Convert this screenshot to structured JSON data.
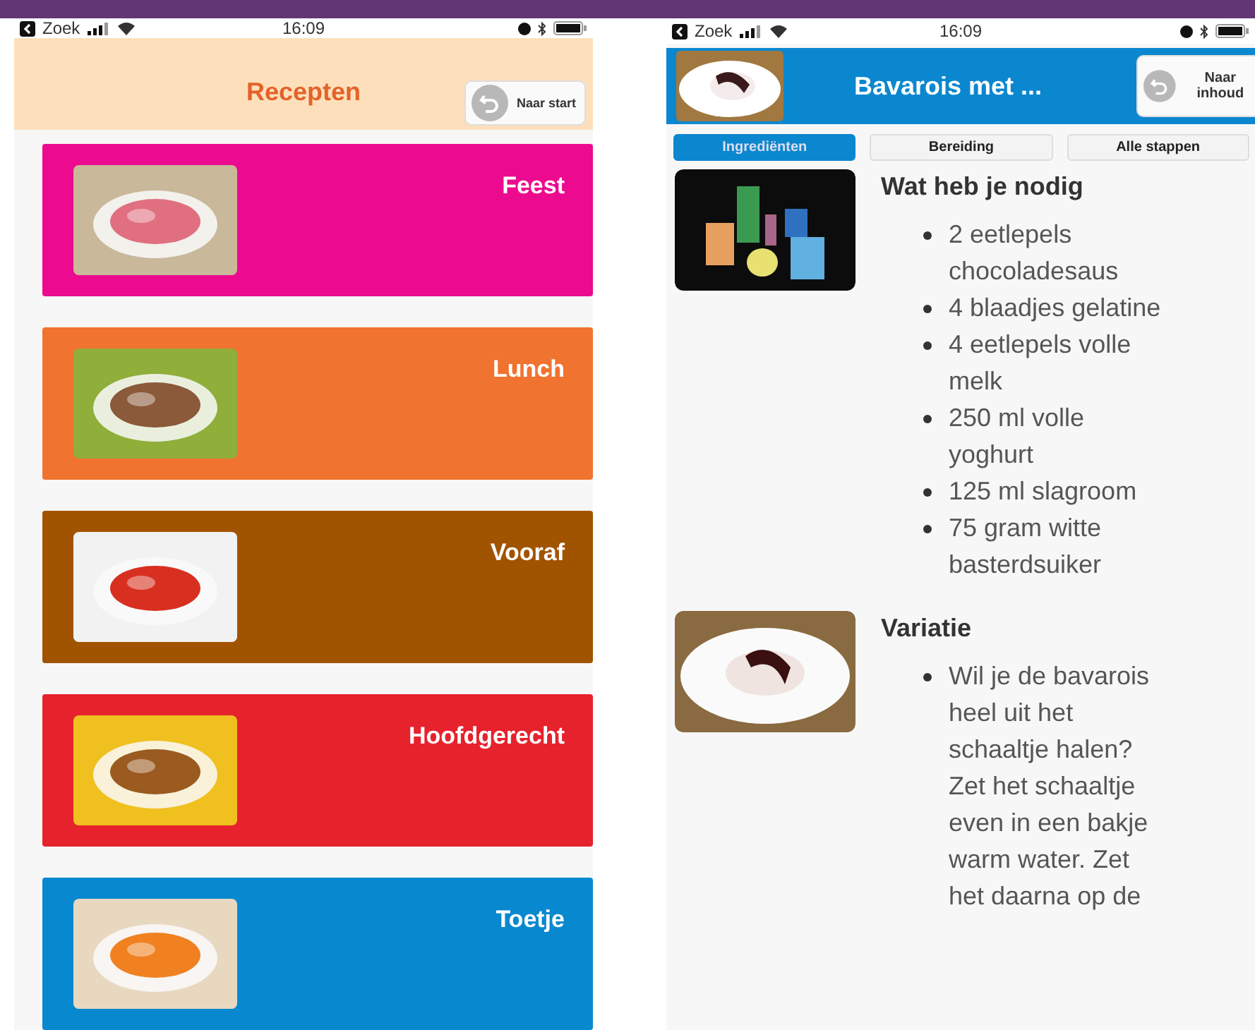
{
  "left_screen": {
    "status_bar": {
      "back_label": "Zoek",
      "time": "16:09"
    },
    "header": {
      "title": "Recepten",
      "button": "Naar start"
    },
    "categories": [
      {
        "label": "Feest",
        "color": "#ec0a8e"
      },
      {
        "label": "Lunch",
        "color": "#f17330"
      },
      {
        "label": "Vooraf",
        "color": "#a15400"
      },
      {
        "label": "Hoofdgerecht",
        "color": "#e6222c"
      },
      {
        "label": "Toetje",
        "color": "#0889cf"
      }
    ]
  },
  "right_screen": {
    "status_bar": {
      "back_label": "Zoek",
      "time": "16:09"
    },
    "header": {
      "title": "Bavarois met ...",
      "button": "Naar inhoud"
    },
    "tabs": [
      {
        "label": "Ingrediënten",
        "selected": true
      },
      {
        "label": "Bereiding",
        "selected": false
      },
      {
        "label": "Alle stappen",
        "selected": false
      }
    ],
    "sections": [
      {
        "title": "Wat heb je nodig",
        "items": [
          "2 eetlepels chocoladesaus",
          "4 blaadjes gelatine",
          "4 eetlepels volle melk",
          "250 ml volle yoghurt",
          "125 ml slagroom",
          "75 gram witte basterdsuiker"
        ]
      },
      {
        "title": "Variatie",
        "items": [
          "Wil je de bavarois heel uit het schaaltje halen? Zet het schaaltje even in een bakje warm water. Zet het daarna op de"
        ]
      }
    ]
  }
}
